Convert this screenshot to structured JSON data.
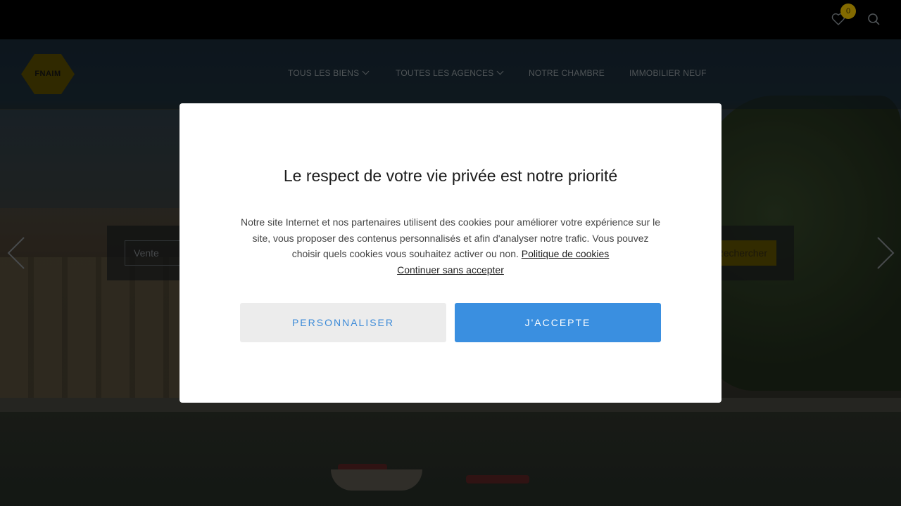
{
  "header": {
    "favorites_count": "0",
    "favorites_icon": "heart-icon",
    "search_icon": "search-icon"
  },
  "logo": {
    "text": "FNAIM",
    "color": "#e8b800"
  },
  "nav": {
    "items": [
      {
        "label": "TOUS LES BIENS",
        "has_dropdown": true
      },
      {
        "label": "TOUTES LES AGENCES",
        "has_dropdown": true
      },
      {
        "label": "NOTRE CHAMBRE",
        "has_dropdown": false
      },
      {
        "label": "IMMOBILIER NEUF",
        "has_dropdown": false
      }
    ]
  },
  "search": {
    "transaction_value": "Vente",
    "submit_label": "Rechercher"
  },
  "carousel": {
    "prev_icon": "chevron-left-icon",
    "next_icon": "chevron-right-icon"
  },
  "cookie_modal": {
    "title": "Le respect de votre vie privée est notre priorité",
    "body": "Notre site Internet et nos partenaires utilisent des cookies pour améliorer votre expérience sur le site, vous proposer des contenus personnalisés et afin d'analyser notre trafic. Vous pouvez choisir quels cookies vous souhaitez activer ou non.",
    "policy_link": "Politique de cookies",
    "continue_link": "Continuer sans accepter",
    "customize_label": "PERSONNALISER",
    "accept_label": "J'ACCEPTE",
    "accent_color": "#3a8fe0"
  }
}
